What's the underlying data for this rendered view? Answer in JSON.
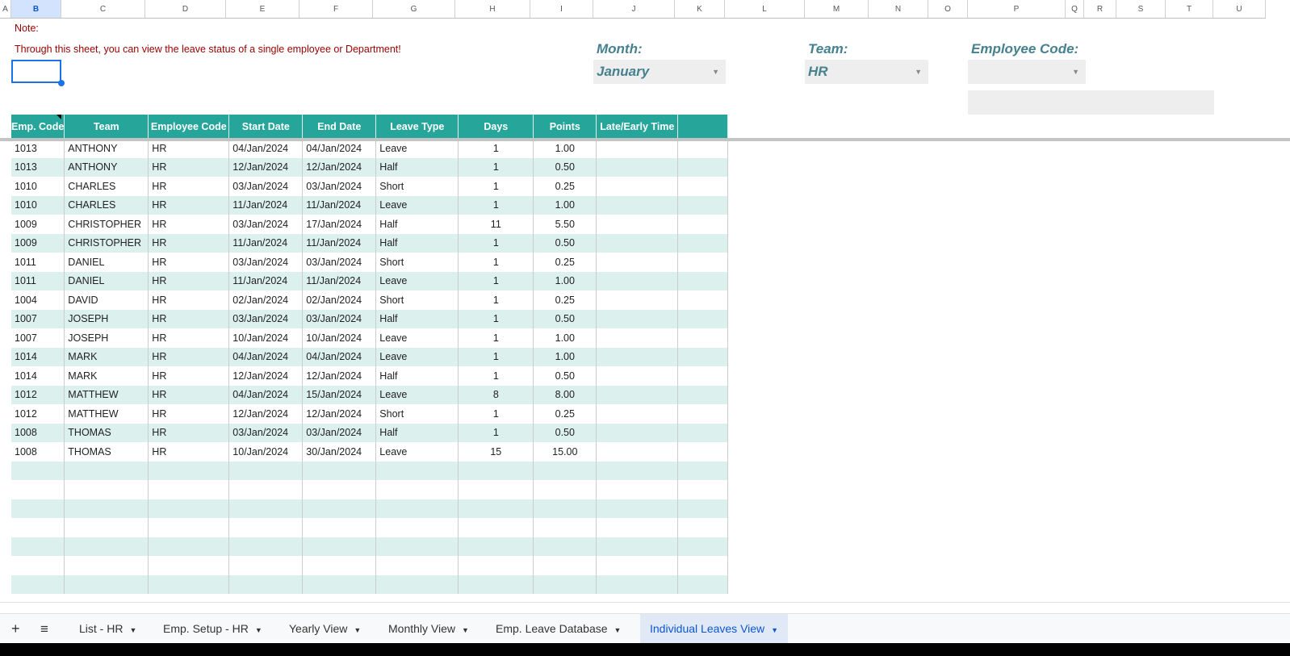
{
  "columns": [
    "A",
    "B",
    "C",
    "D",
    "E",
    "F",
    "G",
    "H",
    "I",
    "J",
    "K",
    "L",
    "M",
    "N",
    "O",
    "P",
    "Q",
    "R",
    "S",
    "T",
    "U"
  ],
  "note": {
    "title": "Note:",
    "text": "Through this sheet, you can view the leave status of a single employee or Department!"
  },
  "filters": {
    "month": {
      "label": "Month:",
      "value": "January"
    },
    "team": {
      "label": "Team:",
      "value": "HR"
    },
    "employee_code": {
      "label": "Employee Code:",
      "value": ""
    }
  },
  "table": {
    "headers": [
      "Emp. Code",
      "Team",
      "Employee Code",
      "Start Date",
      "End Date",
      "Leave Type",
      "Days",
      "Points",
      "Late/Early Time",
      ""
    ],
    "rows": [
      [
        "1013",
        "ANTHONY",
        "HR",
        "04/Jan/2024",
        "04/Jan/2024",
        "Leave",
        "1",
        "1.00"
      ],
      [
        "1013",
        "ANTHONY",
        "HR",
        "12/Jan/2024",
        "12/Jan/2024",
        "Half",
        "1",
        "0.50"
      ],
      [
        "1010",
        "CHARLES",
        "HR",
        "03/Jan/2024",
        "03/Jan/2024",
        "Short",
        "1",
        "0.25"
      ],
      [
        "1010",
        "CHARLES",
        "HR",
        "11/Jan/2024",
        "11/Jan/2024",
        "Leave",
        "1",
        "1.00"
      ],
      [
        "1009",
        "CHRISTOPHER",
        "HR",
        "03/Jan/2024",
        "17/Jan/2024",
        "Half",
        "11",
        "5.50"
      ],
      [
        "1009",
        "CHRISTOPHER",
        "HR",
        "11/Jan/2024",
        "11/Jan/2024",
        "Half",
        "1",
        "0.50"
      ],
      [
        "1011",
        "DANIEL",
        "HR",
        "03/Jan/2024",
        "03/Jan/2024",
        "Short",
        "1",
        "0.25"
      ],
      [
        "1011",
        "DANIEL",
        "HR",
        "11/Jan/2024",
        "11/Jan/2024",
        "Leave",
        "1",
        "1.00"
      ],
      [
        "1004",
        "DAVID",
        "HR",
        "02/Jan/2024",
        "02/Jan/2024",
        "Short",
        "1",
        "0.25"
      ],
      [
        "1007",
        "JOSEPH",
        "HR",
        "03/Jan/2024",
        "03/Jan/2024",
        "Half",
        "1",
        "0.50"
      ],
      [
        "1007",
        "JOSEPH",
        "HR",
        "10/Jan/2024",
        "10/Jan/2024",
        "Leave",
        "1",
        "1.00"
      ],
      [
        "1014",
        "MARK",
        "HR",
        "04/Jan/2024",
        "04/Jan/2024",
        "Leave",
        "1",
        "1.00"
      ],
      [
        "1014",
        "MARK",
        "HR",
        "12/Jan/2024",
        "12/Jan/2024",
        "Half",
        "1",
        "0.50"
      ],
      [
        "1012",
        "MATTHEW",
        "HR",
        "04/Jan/2024",
        "15/Jan/2024",
        "Leave",
        "8",
        "8.00"
      ],
      [
        "1012",
        "MATTHEW",
        "HR",
        "12/Jan/2024",
        "12/Jan/2024",
        "Short",
        "1",
        "0.25"
      ],
      [
        "1008",
        "THOMAS",
        "HR",
        "03/Jan/2024",
        "03/Jan/2024",
        "Half",
        "1",
        "0.50"
      ],
      [
        "1008",
        "THOMAS",
        "HR",
        "10/Jan/2024",
        "30/Jan/2024",
        "Leave",
        "15",
        "15.00"
      ]
    ]
  },
  "sheet_tabs": [
    "List - HR",
    "Emp. Setup - HR",
    "Yearly View",
    "Monthly View",
    "Emp. Leave Database",
    "Individual Leaves View"
  ],
  "active_tab": "Individual Leaves View",
  "colors": {
    "header": "#26a69a",
    "band": "#dcf0ee",
    "note": "#990000",
    "label": "#45818e"
  }
}
